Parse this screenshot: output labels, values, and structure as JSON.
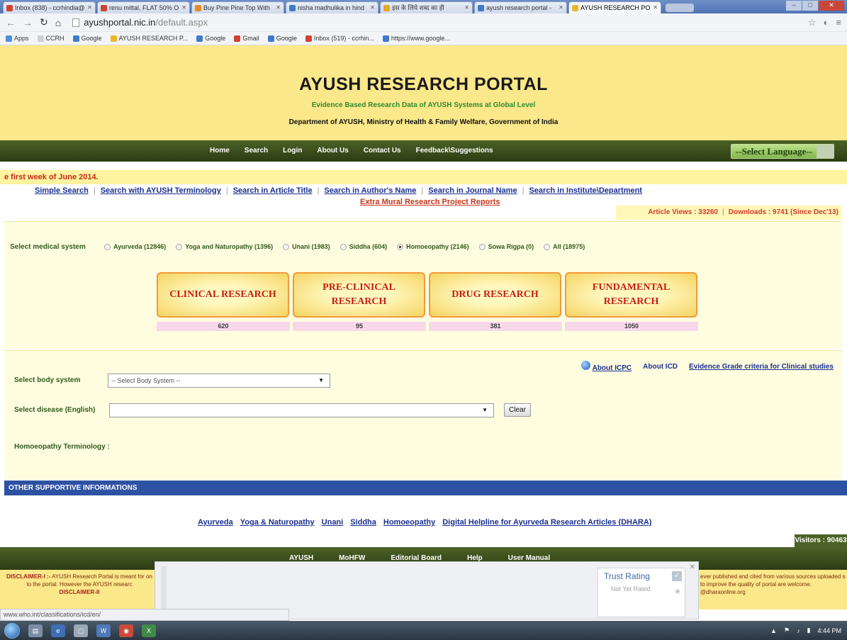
{
  "browser": {
    "tabs": [
      {
        "title": "Inbox (838) - ccrhindia@",
        "color": "#d0412f",
        "active": false
      },
      {
        "title": "renu mittal, FLAT 50% O",
        "color": "#d0412f",
        "active": false
      },
      {
        "title": "Buy Pine Pine Top With",
        "color": "#e98a2a",
        "active": false
      },
      {
        "title": "nisha madhulika in hind",
        "color": "#3f7ac9",
        "active": false
      },
      {
        "title": "इस के लिये शब्द का ही",
        "color": "#e9a82a",
        "active": false
      },
      {
        "title": "ayush research portal -",
        "color": "#3f7ac9",
        "active": false
      },
      {
        "title": "AYUSH RESEARCH POR",
        "color": "#e9b82a",
        "active": true
      }
    ],
    "url_host": "ayushportal.nic.in",
    "url_path": "/default.aspx",
    "bookmarks": [
      {
        "label": "Apps",
        "color": "#4f8ed8"
      },
      {
        "label": "CCRH",
        "color": "#cfcfcf"
      },
      {
        "label": "Google",
        "color": "#3f7ac9"
      },
      {
        "label": "AYUSH RESEARCH P...",
        "color": "#e9b82a"
      },
      {
        "label": "Google",
        "color": "#3f7ac9"
      },
      {
        "label": "Gmail",
        "color": "#d0412f"
      },
      {
        "label": "Google",
        "color": "#3f7ac9"
      },
      {
        "label": "Inbox (519) - ccrhin...",
        "color": "#d0412f"
      },
      {
        "label": "https://www.google...",
        "color": "#3f7ac9"
      }
    ]
  },
  "header": {
    "title": "AYUSH RESEARCH PORTAL",
    "subtitle": "Evidence Based Research Data of AYUSH Systems at Global Level",
    "department": "Department of AYUSH, Ministry of Health & Family Welfare, Government of India"
  },
  "nav": {
    "items": [
      "Home",
      "Search",
      "Login",
      "About Us",
      "Contact Us",
      "Feedback\\Suggestions"
    ],
    "language": "--Select Language--"
  },
  "marquee": "e first week of June 2014.",
  "search_links": [
    "Simple Search",
    "Search with AYUSH Terminology",
    "Search in Article Title",
    "Search in Author's Name",
    "Search in Journal Name",
    "Search in Institute\\Department"
  ],
  "extra_mural": "Extra Mural Research Project Reports",
  "stats": {
    "article_views": "Article Views : 33260",
    "downloads": "Downloads : 9741 (Since Dec'13)"
  },
  "medical": {
    "label": "Select medical system",
    "options": [
      {
        "label": "Ayurveda (12846)",
        "checked": false
      },
      {
        "label": "Yoga and Naturopathy (1396)",
        "checked": false
      },
      {
        "label": "Unani (1983)",
        "checked": false
      },
      {
        "label": "Siddha (604)",
        "checked": false
      },
      {
        "label": "Homoeopathy (2146)",
        "checked": true
      },
      {
        "label": "Sowa Rigpa (0)",
        "checked": false
      },
      {
        "label": "All (18975)",
        "checked": false
      }
    ]
  },
  "categories": [
    {
      "label": "CLINICAL RESEARCH",
      "count": "620"
    },
    {
      "label": "PRE-CLINICAL RESEARCH",
      "count": "95"
    },
    {
      "label": "DRUG RESEARCH",
      "count": "381"
    },
    {
      "label": "FUNDAMENTAL RESEARCH",
      "count": "1050"
    }
  ],
  "about_links": {
    "icpc": "About ICPC",
    "icd": "About ICD",
    "evidence": "Evidence Grade criteria for Clinical studies"
  },
  "body_system": {
    "label": "Select body system",
    "value": "-- Select Body System --"
  },
  "disease": {
    "label": "Select disease (English)",
    "value": "",
    "clear": "Clear"
  },
  "terminology_label": "Homoeopathy Terminology :",
  "other_bar": "OTHER SUPPORTIVE INFORMATIONS",
  "system_links": [
    "Ayurveda",
    "Yoga & Naturopathy",
    "Unani",
    "Siddha",
    "Homoeopathy",
    "Digital Helpline for Ayurveda Research Articles (DHARA)"
  ],
  "visitors": "Visitors : 90463",
  "footer_nav": [
    "AYUSH",
    "MoHFW",
    "Editorial Board",
    "Help",
    "User Manual"
  ],
  "disclaimer": {
    "left_title": "DISCLAIMER-I :-",
    "left_text": "AYUSH Research Portal is meant for on to the portal. However the AYUSH researc",
    "left_title2": "DISCLAIMER-II",
    "right_text": "ever published and cited from various sources uploaded s to improve the quality of portal are welcome. @dharaonline.org"
  },
  "overlay": {
    "title": "Trust Rating",
    "status": "Not Yet Rated"
  },
  "status_url": "www.who.int/classifications/icd/en/",
  "taskbar": {
    "time": "4:44 PM"
  }
}
